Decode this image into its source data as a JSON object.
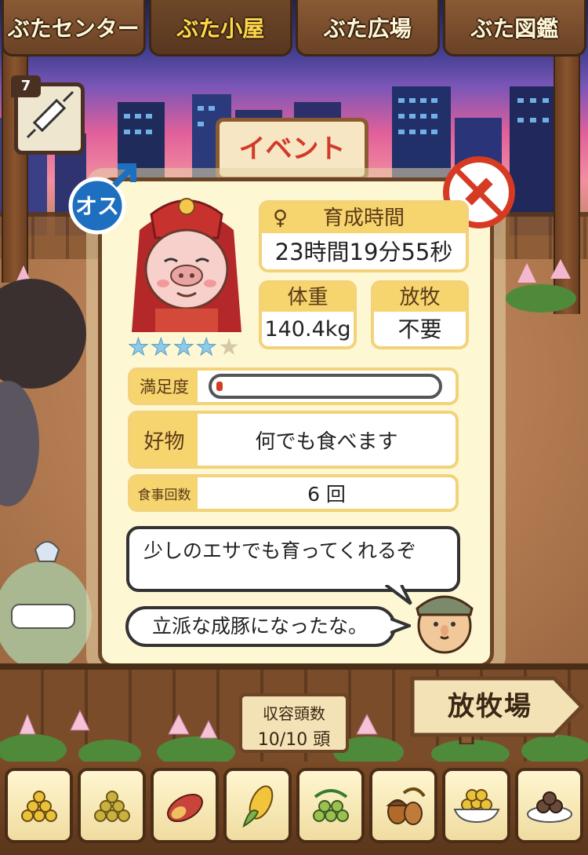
{
  "tabs": [
    {
      "label": "ぶたセンター"
    },
    {
      "label": "ぶた小屋"
    },
    {
      "label": "ぶた広場"
    },
    {
      "label": "ぶた図鑑"
    }
  ],
  "item": {
    "count": "7",
    "icon": "syringe-icon"
  },
  "event_sign": "イベント",
  "pig": {
    "gender_label": "オス",
    "rating_stars": 4,
    "rating_max": 5,
    "growth_time_label": "育成時間",
    "growth_time_value": "23時間19分55秒",
    "weight_label": "体重",
    "weight_value": "140.4kg",
    "grazing_label": "放牧",
    "grazing_value": "不要",
    "satisfaction_label": "満足度",
    "satisfaction_level": 0.03,
    "favorite_label": "好物",
    "favorite_value": "何でも食べます",
    "meals_label": "食事回数",
    "meals_value": "6 回"
  },
  "dialog": {
    "line1": "少しのエサでも育ってくれるぞ",
    "line2": "立派な成豚になったな。"
  },
  "capacity": {
    "label": "収容頭数",
    "value": "10/10 頭"
  },
  "pasture_sign": "放牧場",
  "colors": {
    "accent": "#f6d46e",
    "frame": "#6b4326",
    "gauge": "#d63a22"
  },
  "foods": [
    {
      "icon": "grain-pile-icon"
    },
    {
      "icon": "soybean-pile-icon"
    },
    {
      "icon": "sweet-potato-icon"
    },
    {
      "icon": "corn-icon"
    },
    {
      "icon": "green-beans-icon"
    },
    {
      "icon": "acorn-icon"
    },
    {
      "icon": "grain-bowl-icon"
    },
    {
      "icon": "meat-balls-plate-icon"
    }
  ]
}
